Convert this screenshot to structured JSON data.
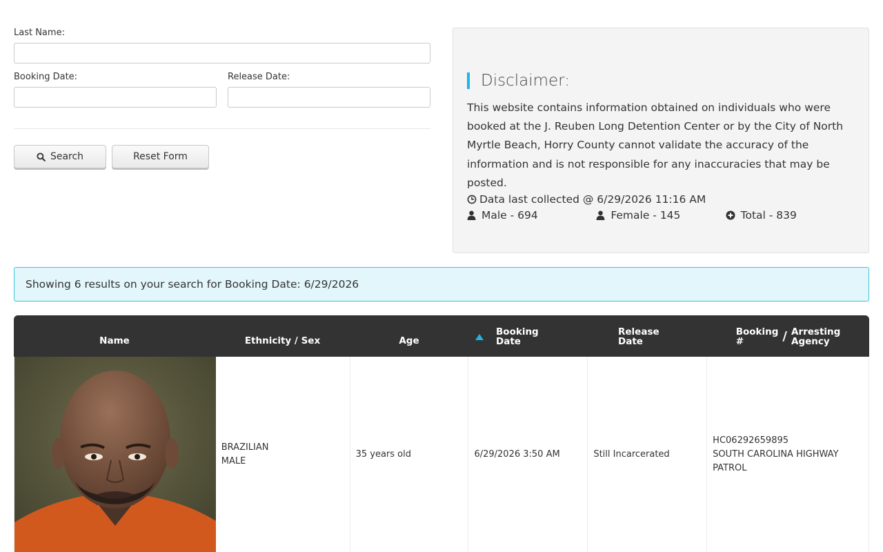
{
  "form": {
    "last_name_label": "Last Name:",
    "last_name_value": "",
    "booking_date_label": "Booking Date:",
    "booking_date_value": "",
    "release_date_label": "Release Date:",
    "release_date_value": "",
    "search_label": "Search",
    "reset_label": "Reset Form"
  },
  "disclaimer": {
    "title": "Disclaimer:",
    "text": "This website contains information obtained on individuals who were booked at the J. Reuben Long Detention Center or by the City of North Myrtle Beach, Horry County cannot validate the accuracy of the information and is not responsible for any inaccuracies that may be posted.",
    "collected": "Data last collected @ 6/29/2026 11:16 AM",
    "male": "Male - 694",
    "female": "Female - 145",
    "total": "Total - 839"
  },
  "results": {
    "message": "Showing 6 results on your search for Booking Date: 6/29/2026"
  },
  "table": {
    "headers": {
      "name": "Name",
      "ethnicity_sex": "Ethnicity / Sex",
      "age": "Age",
      "booking_date_1": "Booking",
      "booking_date_2": "Date",
      "release_date_1": "Release",
      "release_date_2": "Date",
      "booking_no_1": "Booking",
      "booking_no_2": "#",
      "slash": "/",
      "agency_1": "Arresting",
      "agency_2": "Agency"
    },
    "rows": [
      {
        "ethnicity": "BRAZILIAN",
        "sex": "MALE",
        "age": "35 years old",
        "booking_date": "6/29/2026 3:50 AM",
        "release_date": "Still Incarcerated",
        "booking_number": "HC06292659895",
        "agency": "SOUTH CAROLINA HIGHWAY PATROL"
      }
    ]
  },
  "colors": {
    "accent": "#1db5e6",
    "header_bg": "#333333",
    "alert_bg": "#e2f6fb",
    "alert_border": "#3cc2d6",
    "panel_bg": "#f4f4f4"
  }
}
